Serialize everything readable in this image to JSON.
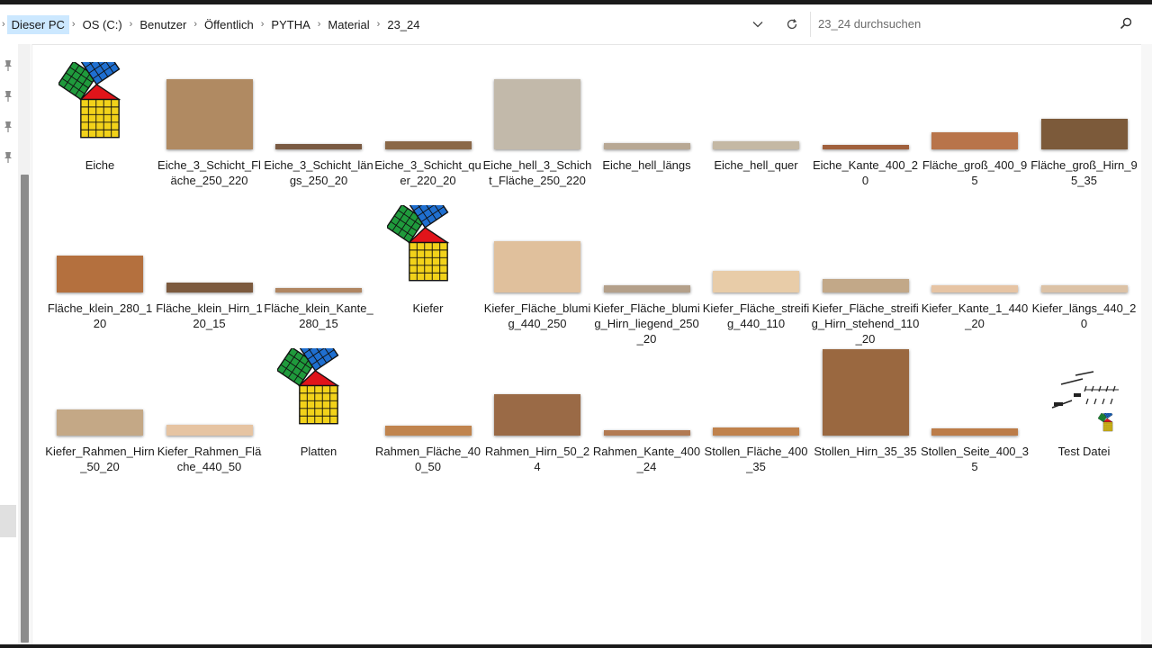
{
  "breadcrumb": [
    "Dieser PC",
    "OS (C:)",
    "Benutzer",
    "Öffentlich",
    "PYTHA",
    "Material",
    "23_24"
  ],
  "search": {
    "placeholder": "23_24 durchsuchen"
  },
  "icons": {
    "history": "chevron-down-icon",
    "refresh": "refresh-icon",
    "search": "search-icon",
    "pins": [
      "pin-icon",
      "pin-icon",
      "pin-icon",
      "pin-icon"
    ]
  },
  "files": [
    {
      "name": "Eiche",
      "kind": "pytha-folder"
    },
    {
      "name": "Eiche_3_Schicht_Fläche_250_220",
      "kind": "texture",
      "color": "#b08a62"
    },
    {
      "name": "Eiche_3_Schicht_längs_250_20",
      "kind": "texture",
      "color": "#7a5a42"
    },
    {
      "name": "Eiche_3_Schicht_quer_220_20",
      "kind": "texture",
      "color": "#8a6848"
    },
    {
      "name": "Eiche_hell_3_Schicht_Fläche_250_220",
      "kind": "texture",
      "color": "#c2b9aa"
    },
    {
      "name": "Eiche_hell_längs",
      "kind": "texture",
      "color": "#b8a894"
    },
    {
      "name": "Eiche_hell_quer",
      "kind": "texture",
      "color": "#c4b8a4"
    },
    {
      "name": "Eiche_Kante_400_20",
      "kind": "texture",
      "color": "#a0603c"
    },
    {
      "name": "Fläche_groß_400_95",
      "kind": "texture",
      "color": "#b8744a"
    },
    {
      "name": "Fläche_groß_Hirn_95_35",
      "kind": "texture",
      "color": "#7c5a3a"
    },
    {
      "name": "Fläche_klein_280_120",
      "kind": "texture",
      "color": "#b4703e"
    },
    {
      "name": "Fläche_klein_Hirn_120_15",
      "kind": "texture",
      "color": "#7c5a3e"
    },
    {
      "name": "Fläche_klein_Kante_280_15",
      "kind": "texture",
      "color": "#b08662"
    },
    {
      "name": "Kiefer",
      "kind": "pytha-folder"
    },
    {
      "name": "Kiefer_Fläche_blumig_440_250",
      "kind": "texture",
      "color": "#e0c09c"
    },
    {
      "name": "Kiefer_Fläche_blumig_Hirn_liegend_250_20",
      "kind": "texture",
      "color": "#b4a08a"
    },
    {
      "name": "Kiefer_Fläche_streifig_440_110",
      "kind": "texture",
      "color": "#e8cca8"
    },
    {
      "name": "Kiefer_Fläche_streifig_Hirn_stehend_110_20",
      "kind": "texture",
      "color": "#c2a888"
    },
    {
      "name": "Kiefer_Kante_1_440_20",
      "kind": "texture",
      "color": "#e6c4a4"
    },
    {
      "name": "Kiefer_längs_440_20",
      "kind": "texture",
      "color": "#dcc2a6"
    },
    {
      "name": "Kiefer_Rahmen_Hirn_50_20",
      "kind": "texture",
      "color": "#c4a886"
    },
    {
      "name": "Kiefer_Rahmen_Fläche_440_50",
      "kind": "texture",
      "color": "#e6c4a2"
    },
    {
      "name": "Platten",
      "kind": "pytha-folder"
    },
    {
      "name": "Rahmen_Fläche_400_50",
      "kind": "texture",
      "color": "#c0844e"
    },
    {
      "name": "Rahmen_Hirn_50_24",
      "kind": "texture",
      "color": "#9a6a46"
    },
    {
      "name": "Rahmen_Kante_400_24",
      "kind": "texture",
      "color": "#b27a52"
    },
    {
      "name": "Stollen_Fläche_400_35",
      "kind": "texture",
      "color": "#c0824c"
    },
    {
      "name": "Stollen_Hirn_35_35",
      "kind": "texture",
      "color": "#9a6840"
    },
    {
      "name": "Stollen_Seite_400_35",
      "kind": "texture",
      "color": "#bc7c48"
    },
    {
      "name": "Test Datei",
      "kind": "drawing"
    }
  ]
}
